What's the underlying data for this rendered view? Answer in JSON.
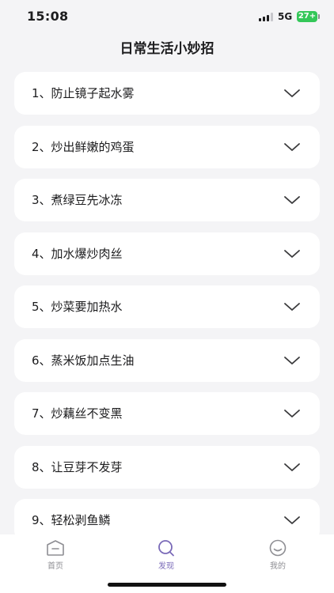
{
  "status_bar": {
    "time": "15:08",
    "network": "5G",
    "battery": "27+",
    "battery_color": "#34c759"
  },
  "header": {
    "title": "日常生活小妙招"
  },
  "tips": [
    {
      "label": "1、防止镜子起水雾"
    },
    {
      "label": "2、炒出鲜嫩的鸡蛋"
    },
    {
      "label": "3、煮绿豆先冰冻"
    },
    {
      "label": "4、加水爆炒肉丝"
    },
    {
      "label": "5、炒菜要加热水"
    },
    {
      "label": "6、蒸米饭加点生油"
    },
    {
      "label": "7、炒藕丝不变黑"
    },
    {
      "label": "8、让豆芽不发芽"
    },
    {
      "label": "9、轻松剥鱼鳞"
    }
  ],
  "tab_bar": {
    "items": [
      {
        "label": "首页",
        "icon": "home-icon"
      },
      {
        "label": "发现",
        "icon": "search-icon",
        "active": true
      },
      {
        "label": "我的",
        "icon": "smiley-icon"
      }
    ],
    "active_color": "#7a6ab8",
    "inactive_color": "#8e8e93"
  }
}
